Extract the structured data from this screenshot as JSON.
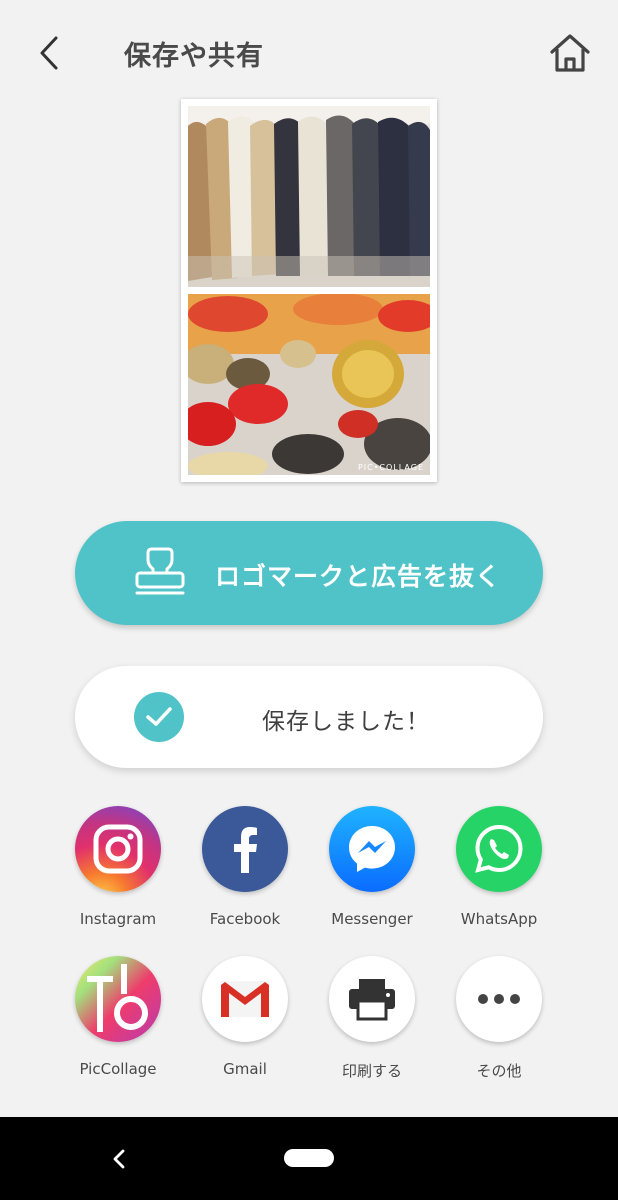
{
  "header": {
    "title": "保存や共有",
    "back_icon": "chevron-left-icon",
    "home_icon": "home-icon"
  },
  "preview": {
    "watermark": "PIC•COLLAGE",
    "photos": [
      "coats-on-rack-photo",
      "buttons-closeup-photo"
    ]
  },
  "remove_ads": {
    "label": "ロゴマークと広告を抜く",
    "icon": "stamp-icon",
    "color": "#4fc3c8"
  },
  "saved": {
    "label": "保存しました！",
    "icon": "check-icon"
  },
  "share": [
    {
      "label": "Instagram",
      "icon": "instagram-icon"
    },
    {
      "label": "Facebook",
      "icon": "facebook-icon"
    },
    {
      "label": "Messenger",
      "icon": "messenger-icon"
    },
    {
      "label": "WhatsApp",
      "icon": "whatsapp-icon"
    },
    {
      "label": "PicCollage",
      "icon": "piccollage-icon"
    },
    {
      "label": "Gmail",
      "icon": "gmail-icon"
    },
    {
      "label": "印刷する",
      "icon": "printer-icon"
    },
    {
      "label": "その他",
      "icon": "more-icon"
    }
  ],
  "navbar": {
    "back_icon": "nav-back-icon",
    "home_icon": "nav-home-pill"
  }
}
